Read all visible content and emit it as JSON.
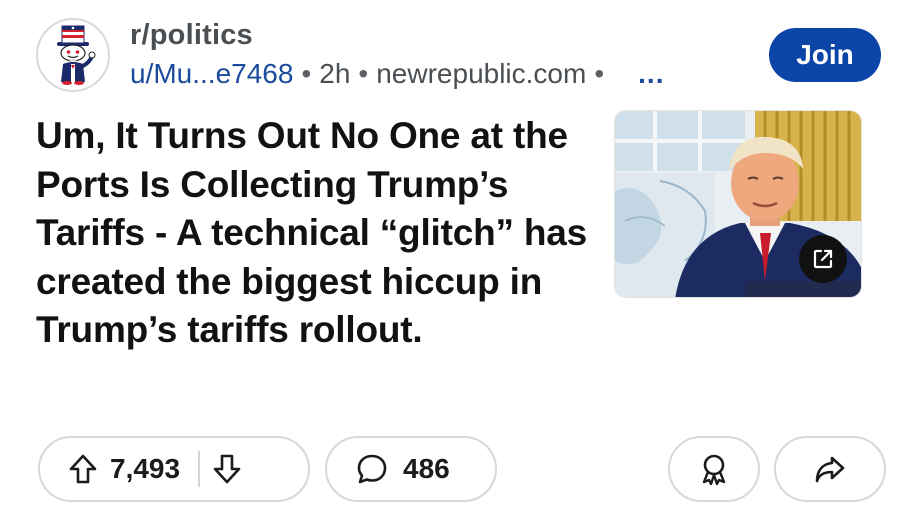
{
  "post": {
    "subreddit": "r/politics",
    "author": "u/Mu...e7468",
    "separator": "•",
    "time": "2h",
    "domain": "newrepublic.com",
    "more": "...",
    "join_label": "Join",
    "title": "Um, It Turns Out No One at the Ports Is Collecting Trump’s Tariffs - A technical “glitch” has created the biggest hiccup in Trump’s tariffs rollout.",
    "thumbnail": {
      "icon": "external-link-icon"
    }
  },
  "actions": {
    "upvote_icon": "arrow-up-icon",
    "score": "7,493",
    "downvote_icon": "arrow-down-icon",
    "comment_icon": "comment-bubble-icon",
    "comments": "486",
    "award_icon": "award-icon",
    "share_icon": "share-arrow-icon"
  },
  "colors": {
    "join_button": "#0c45a8",
    "link_text": "#1a4b9c",
    "meta_text": "#4a4f54",
    "pill_border": "#d8d8d8"
  }
}
